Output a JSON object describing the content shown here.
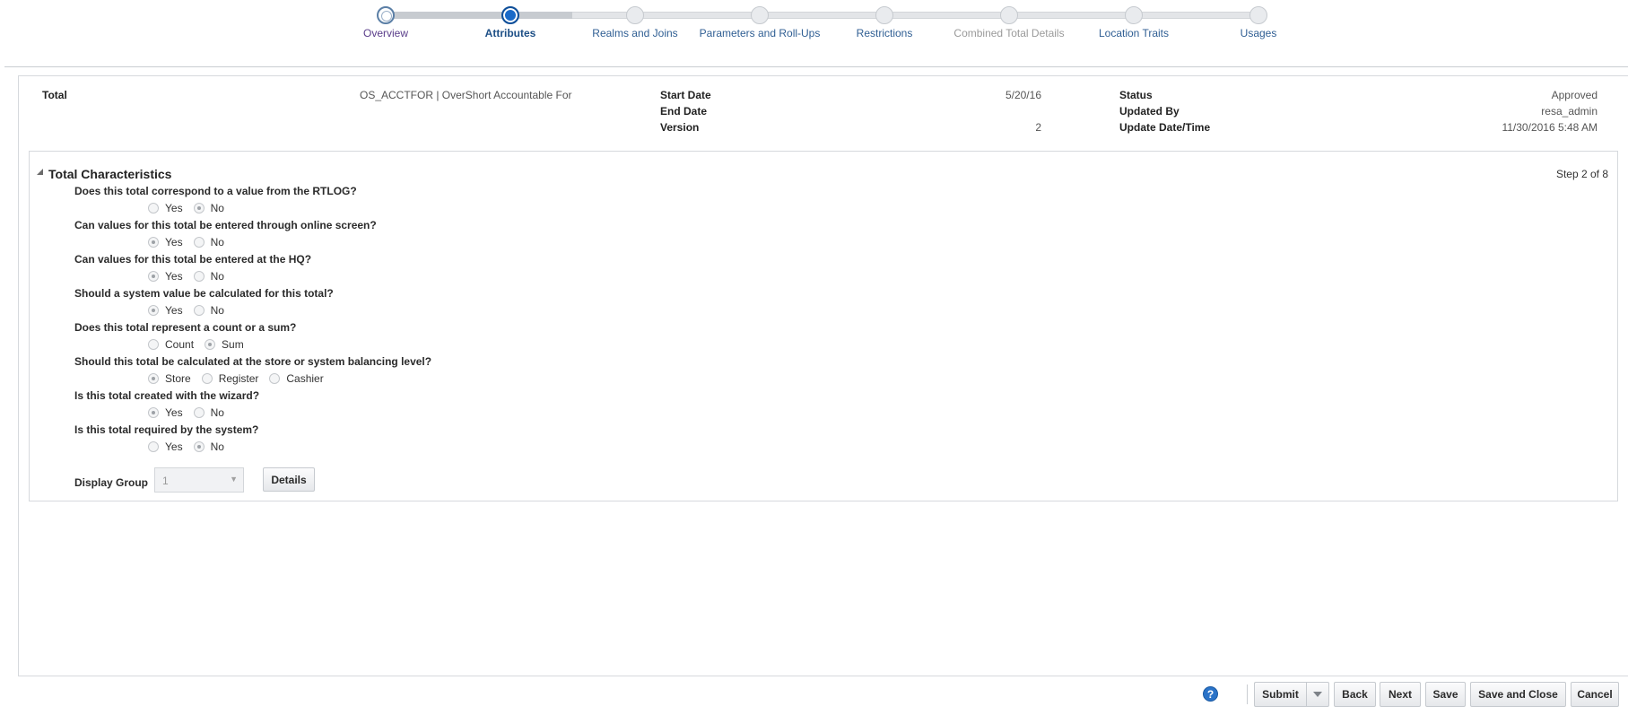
{
  "train": {
    "stops": [
      {
        "label": "Overview",
        "state": "visited"
      },
      {
        "label": "Attributes",
        "state": "current"
      },
      {
        "label": "Realms and Joins",
        "state": "normal"
      },
      {
        "label": "Parameters and Roll-Ups",
        "state": "normal"
      },
      {
        "label": "Restrictions",
        "state": "normal"
      },
      {
        "label": "Combined Total Details",
        "state": "disabled"
      },
      {
        "label": "Location Traits",
        "state": "normal"
      },
      {
        "label": "Usages",
        "state": "normal"
      }
    ]
  },
  "header": {
    "total_label": "Total",
    "total_value": "OS_ACCTFOR | OverShort Accountable For",
    "start_date_label": "Start Date",
    "start_date_value": "5/20/16",
    "end_date_label": "End Date",
    "end_date_value": "",
    "version_label": "Version",
    "version_value": "2",
    "status_label": "Status",
    "status_value": "Approved",
    "updated_by_label": "Updated By",
    "updated_by_value": "resa_admin",
    "update_datetime_label": "Update Date/Time",
    "update_datetime_value": "11/30/2016 5:48 AM"
  },
  "characteristics": {
    "title": "Total Characteristics",
    "step_text": "Step 2 of 8",
    "questions": [
      {
        "text": "Does this total correspond to a value from the RTLOG?",
        "options": [
          "Yes",
          "No"
        ],
        "selected": "No"
      },
      {
        "text": "Can values for this total be entered through online screen?",
        "options": [
          "Yes",
          "No"
        ],
        "selected": "Yes"
      },
      {
        "text": "Can values for this total be entered at the HQ?",
        "options": [
          "Yes",
          "No"
        ],
        "selected": "Yes"
      },
      {
        "text": "Should a system value be calculated for this total?",
        "options": [
          "Yes",
          "No"
        ],
        "selected": "Yes"
      },
      {
        "text": "Does this total represent a count or a sum?",
        "options": [
          "Count",
          "Sum"
        ],
        "selected": "Sum"
      },
      {
        "text": "Should this total be calculated at the store or system balancing level?",
        "options": [
          "Store",
          "Register",
          "Cashier"
        ],
        "selected": "Store"
      },
      {
        "text": "Is this total created with the wizard?",
        "options": [
          "Yes",
          "No"
        ],
        "selected": "Yes"
      },
      {
        "text": "Is this total required by the system?",
        "options": [
          "Yes",
          "No"
        ],
        "selected": "No"
      }
    ],
    "display_group_label": "Display Group",
    "display_group_value": "1",
    "details_button": "Details"
  },
  "footer": {
    "help_glyph": "?",
    "submit": "Submit",
    "back": "Back",
    "next": "Next",
    "save": "Save",
    "save_and_close": "Save and Close",
    "cancel": "Cancel"
  },
  "colors": {
    "accent": "#1a6ac8",
    "link": "#2f5e93",
    "visited": "#5a3d8a",
    "disabled": "#9a9a9a"
  }
}
